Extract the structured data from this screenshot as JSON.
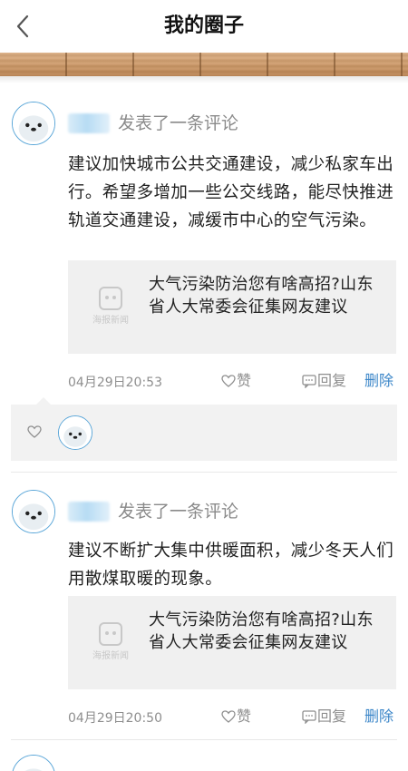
{
  "header": {
    "title": "我的圈子"
  },
  "colors": {
    "accent_blue": "#3a85c8",
    "avatar_ring": "#5aa6d8",
    "muted_text": "#8e8e8e"
  },
  "posts": [
    {
      "action": "发表了一条评论",
      "content": "建议加快城市公共交通建设，减少私家车出行。希望多增加一些公交线路，能尽快推进轨道交通建设，减缓市中心的空气污染。",
      "news": {
        "title": "大气污染防治您有啥高招?山东省人大常委会征集网友建议",
        "thumb_label": "海报新闻"
      },
      "time": "04月29日20:53",
      "like_label": "赞",
      "reply_label": "回复",
      "delete_label": "删除"
    },
    {
      "action": "发表了一条评论",
      "content": "建议不断扩大集中供暖面积，减少冬天人们用散煤取暖的现象。",
      "news": {
        "title": "大气污染防治您有啥高招?山东省人大常委会征集网友建议",
        "thumb_label": "海报新闻"
      },
      "time": "04月29日20:50",
      "like_label": "赞",
      "reply_label": "回复",
      "delete_label": "删除"
    }
  ],
  "icons": {
    "back": "chevron-left-icon",
    "like": "heart-outline-icon",
    "reply": "comment-icon",
    "avatar": "seal-avatar-icon"
  }
}
